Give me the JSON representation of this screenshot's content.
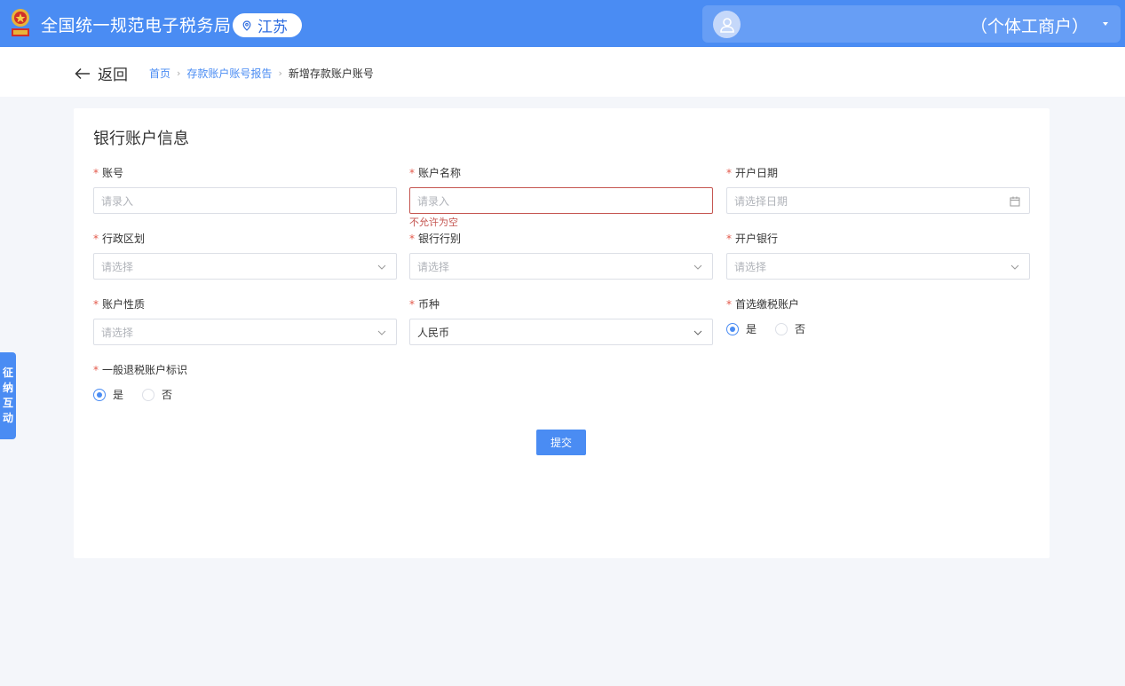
{
  "header": {
    "site_title": "全国统一规范电子税务局",
    "region": "江苏",
    "user_name": "（个体工商户）"
  },
  "nav": {
    "back_label": "返回",
    "breadcrumb": [
      "首页",
      "存款账户账号报告",
      "新增存款账户账号"
    ]
  },
  "form": {
    "title": "银行账户信息",
    "required_mark": "*",
    "fields": {
      "account_no": {
        "label": "账号",
        "placeholder": "请录入"
      },
      "account_name": {
        "label": "账户名称",
        "placeholder": "请录入",
        "error": "不允许为空"
      },
      "open_date": {
        "label": "开户日期",
        "placeholder": "请选择日期"
      },
      "admin_region": {
        "label": "行政区划",
        "placeholder": "请选择"
      },
      "bank_type": {
        "label": "银行行别",
        "placeholder": "请选择"
      },
      "open_bank": {
        "label": "开户银行",
        "placeholder": "请选择"
      },
      "account_nature": {
        "label": "账户性质",
        "placeholder": "请选择"
      },
      "currency": {
        "label": "币种",
        "value": "人民币"
      },
      "preferred_tax": {
        "label": "首选缴税账户",
        "options": [
          "是",
          "否"
        ],
        "selected": "是"
      },
      "refund_flag": {
        "label": "一般退税账户标识",
        "options": [
          "是",
          "否"
        ],
        "selected": "是"
      }
    },
    "submit_label": "提交"
  },
  "side_tab": {
    "chars": [
      "征",
      "纳",
      "互",
      "动"
    ]
  },
  "colors": {
    "primary": "#4a8cf3",
    "error": "#c55651",
    "required": "#e3584a"
  }
}
